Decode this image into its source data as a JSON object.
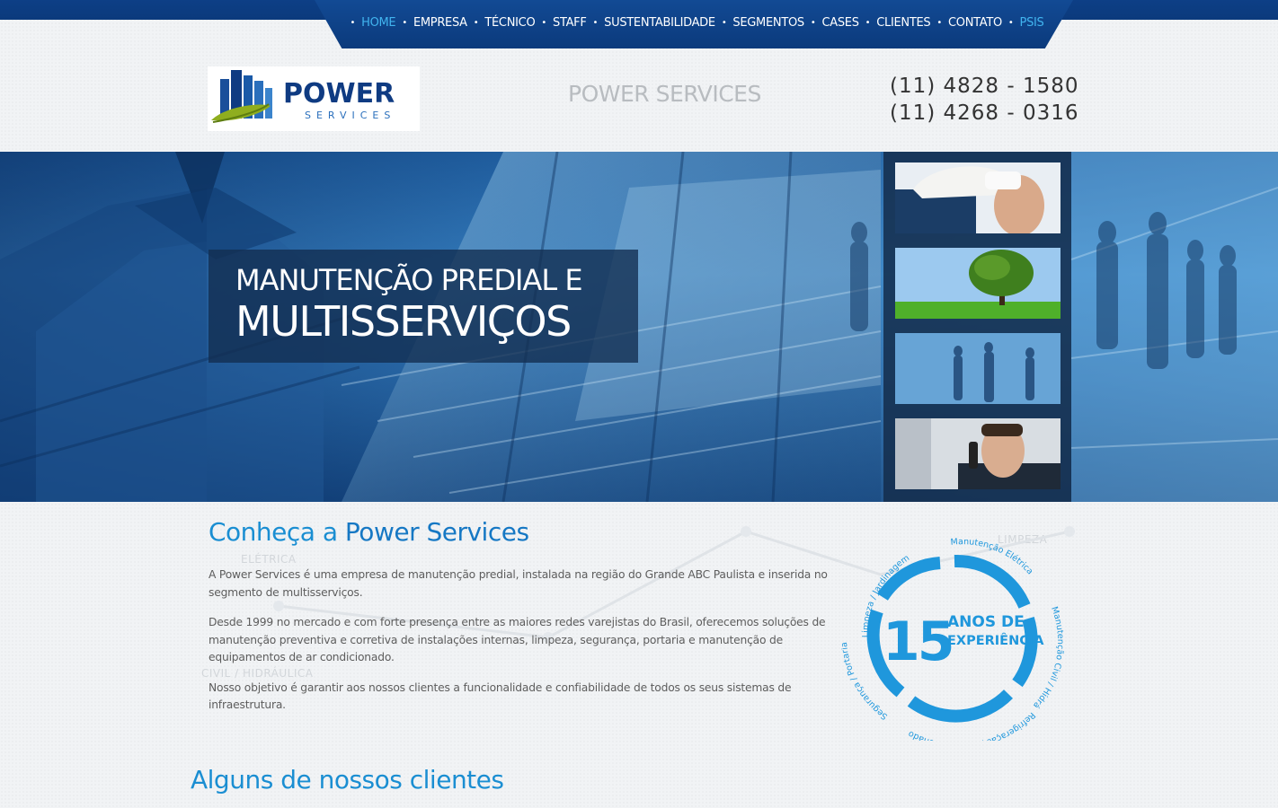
{
  "nav": {
    "items": [
      {
        "label": "HOME"
      },
      {
        "label": "EMPRESA"
      },
      {
        "label": "TÉCNICO"
      },
      {
        "label": "STAFF"
      },
      {
        "label": "SUSTENTABILIDADE"
      },
      {
        "label": "SEGMENTOS"
      },
      {
        "label": "CASES"
      },
      {
        "label": "CLIENTES"
      },
      {
        "label": "CONTATO"
      },
      {
        "label": "PSIS"
      }
    ]
  },
  "header": {
    "logo_word": "POWER",
    "logo_sub": "SERVICES",
    "site_title": "POWER SERVICES",
    "phone_1": "(11) 4828 - 1580",
    "phone_2": "(11) 4268 - 0316"
  },
  "hero": {
    "line1": "MANUTENÇÃO PREDIAL E",
    "line2": "MULTISSERVIÇOS"
  },
  "about": {
    "title_prefix": "Conheça a ",
    "title_strong": "Power Services",
    "p1": "A Power Services é uma empresa de manutenção predial, instalada na região do Grande ABC Paulista e inserida no segmento de multisserviços.",
    "p2": "Desde 1999 no mercado e com forte presença entre as maiores redes varejistas do Brasil, oferecemos soluções de manutenção preventiva e corretiva de instalações internas, limpeza, segurança, portaria e manutenção de equipamentos de ar condicionado.",
    "p3": "Nosso objetivo é garantir aos nossos clientes a funcionalidade e confiabilidade de todos os seus sistemas de infraestrutura."
  },
  "watermarks": {
    "eletrica": "ELÉTRICA",
    "civil": "CIVIL / HIDRÁULICA",
    "limpeza": "LIMPEZA"
  },
  "badge": {
    "number": "15",
    "line1": "ANOS DE",
    "line2": "EXPERIÊNCIA",
    "ring_top_left": "Limpeza / Jardinagem",
    "ring_top_right": "Manutenção Elétrica",
    "ring_right": "Manutenção Civil / Hidráulica",
    "ring_bottom": "Refrigeração / Ar Condicionado",
    "ring_left": "Segurança / Portaria"
  },
  "clients": {
    "title": "Alguns de nossos clientes"
  },
  "colors": {
    "nav_bg": "#0b3a7c",
    "nav_active": "#41b4ef",
    "accent_blue": "#1a8ed2",
    "hero_caption_bg": "#122d50"
  }
}
